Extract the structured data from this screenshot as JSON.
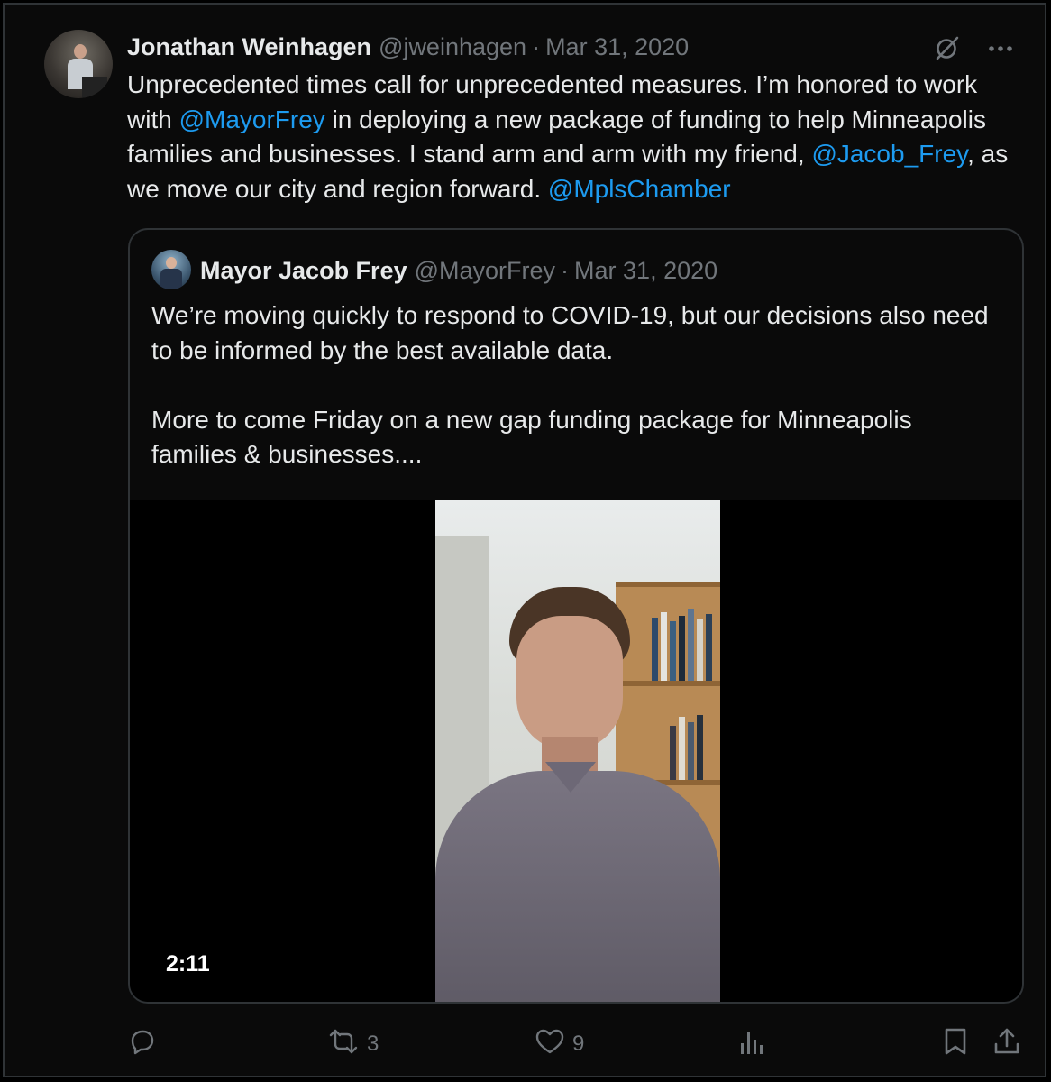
{
  "tweet": {
    "author": {
      "name": "Jonathan Weinhagen",
      "handle": "@jweinhagen",
      "date": "Mar 31, 2020"
    },
    "separator": "·",
    "text": {
      "part1": "Unprecedented times call for unprecedented measures. I’m honored to work with ",
      "mention1": "@MayorFrey",
      "part2": " in deploying a new package of funding to help Minneapolis families and businesses. I stand arm and arm with my friend, ",
      "mention2": "@Jacob_Frey",
      "part3": ", as we move our city and region forward. ",
      "mention3": "@MplsChamber"
    },
    "top_icons": [
      "grok-icon",
      "more-icon"
    ]
  },
  "quoted": {
    "author": {
      "name": "Mayor Jacob Frey",
      "handle": "@MayorFrey",
      "date": "Mar 31, 2020"
    },
    "separator": "·",
    "paragraph1": "We’re moving quickly to respond to COVID-19, but our decisions also need to be informed by the best available data.",
    "paragraph2": "More to come Friday on a new gap funding package for Minneapolis families & businesses....",
    "video": {
      "duration": "2:11"
    }
  },
  "actions": {
    "reply": {
      "icon": "reply-icon"
    },
    "retweet": {
      "icon": "retweet-icon",
      "count": "3"
    },
    "like": {
      "icon": "heart-icon",
      "count": "9"
    },
    "views": {
      "icon": "views-icon"
    },
    "bookmark": {
      "icon": "bookmark-icon"
    },
    "share": {
      "icon": "share-icon"
    }
  },
  "colors": {
    "background": "#000000",
    "text": "#e7e9ea",
    "muted": "#71767b",
    "link": "#1d9bf0",
    "border": "#2f3336"
  }
}
